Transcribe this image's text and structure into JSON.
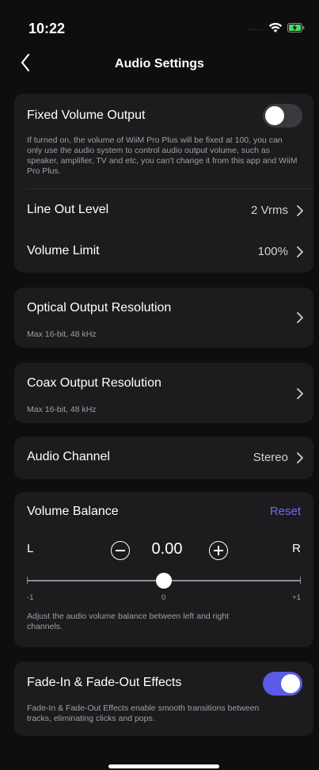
{
  "status_bar": {
    "time": "10:22",
    "signal_dots": ".....",
    "icons": [
      "wifi-icon",
      "battery-charging-icon"
    ]
  },
  "nav": {
    "title": "Audio Settings",
    "back_icon": "chevron-left-icon"
  },
  "output": {
    "fixed_volume": {
      "title": "Fixed Volume Output",
      "enabled": false,
      "description": "If turned on, the volume of WiiM Pro Plus will be fixed at 100, you can only use the audio system to control audio output volume, such as speaker, amplifier, TV and etc, you can't change it from this app and WiiM Pro Plus."
    },
    "line_out": {
      "title": "Line Out Level",
      "value": "2 Vrms"
    },
    "volume_limit": {
      "title": "Volume Limit",
      "value": "100%"
    }
  },
  "optical": {
    "title": "Optical Output Resolution",
    "subtitle": "Max 16-bit, 48 kHz"
  },
  "coax": {
    "title": "Coax Output Resolution",
    "subtitle": "Max 16-bit, 48 kHz"
  },
  "audio_channel": {
    "title": "Audio Channel",
    "value": "Stereo"
  },
  "balance": {
    "title": "Volume Balance",
    "reset_label": "Reset",
    "left_label": "L",
    "right_label": "R",
    "value": "0.00",
    "slider_min_label": "-1",
    "slider_mid_label": "0",
    "slider_max_label": "+1",
    "slider_fraction": 0.5,
    "description": "Adjust the audio volume balance between left and right channels."
  },
  "fade": {
    "title": "Fade-In & Fade-Out Effects",
    "enabled": true,
    "description": "Fade-In & Fade-Out Effects enable smooth transitions between tracks, eliminating clicks and pops."
  },
  "colors": {
    "background": "#0e0e10",
    "card": "#1c1c1e",
    "accent": "#5b5be8",
    "link": "#6b6bff",
    "secondary_text": "#a0a0a5"
  }
}
